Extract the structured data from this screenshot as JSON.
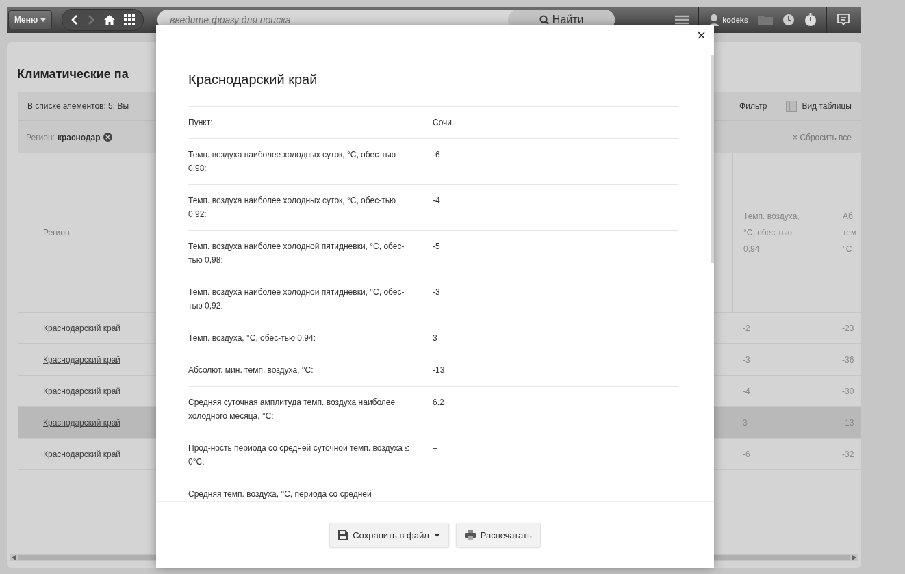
{
  "toolbar": {
    "menu_label": "Меню",
    "search": {
      "placeholder": "введите фразу для поиска"
    },
    "search_button": "Найти",
    "user": "kodeks"
  },
  "page": {
    "title": "Климатические па",
    "summary": "В списке элементов: 5; Вы",
    "filter_button": "Фильтр",
    "table_view_button": "Вид таблицы",
    "filter_tag": {
      "label": "Регион:",
      "value": "краснодар"
    },
    "reset_button": "× Сбросить все"
  },
  "table": {
    "columns": [
      "Регион",
      "Темп. воздуха, °C, обес-тью 0,94",
      "Аб тем °C"
    ],
    "rows": [
      {
        "cells": [
          "Краснодарский край",
          "-2",
          "-23"
        ],
        "selected": false
      },
      {
        "cells": [
          "Краснодарский край",
          "-3",
          "-36"
        ],
        "selected": false
      },
      {
        "cells": [
          "Краснодарский край",
          "-4",
          "-30"
        ],
        "selected": false
      },
      {
        "cells": [
          "Краснодарский край",
          "3",
          "-13"
        ],
        "selected": true
      },
      {
        "cells": [
          "Краснодарский край",
          "-6",
          "-32"
        ],
        "selected": false
      }
    ]
  },
  "dialog": {
    "title": "Краснодарский край",
    "close": "×",
    "rows": [
      {
        "label": "Пункт:",
        "value": "Сочи"
      },
      {
        "label": "Темп. воздуха наиболее холодных суток, °C, обес-тью 0,98:",
        "value": "-6"
      },
      {
        "label": "Темп. воздуха наиболее холодных суток, °C, обес-тью 0,92:",
        "value": "-4"
      },
      {
        "label": "Темп. воздуха наиболее холодной пятидневки, °C, обес-тью 0,98:",
        "value": "-5"
      },
      {
        "label": "Темп. воздуха наиболее холодной пятидневки, °C, обес-тью 0,92:",
        "value": "-3"
      },
      {
        "label": "Темп. воздуха, °C, обес-тью 0,94:",
        "value": "3"
      },
      {
        "label": "Абсолют. мин. темп. воздуха, °C:",
        "value": "-13"
      },
      {
        "label": "Средняя суточная амплитуда темп. воздуха наиболее холодного месяца, °C:",
        "value": "6.2"
      },
      {
        "label": "Прод-ность периода со средней суточной темп. воздуха ≤ 0°C:",
        "value": "–"
      },
      {
        "label": "Средняя темп. воздуха, °C, периода со средней"
      }
    ],
    "buttons": [
      {
        "kind": "save",
        "label": "Сохранить в файл",
        "dropdown": true
      },
      {
        "kind": "print",
        "label": "Распечатать",
        "dropdown": false
      }
    ]
  }
}
